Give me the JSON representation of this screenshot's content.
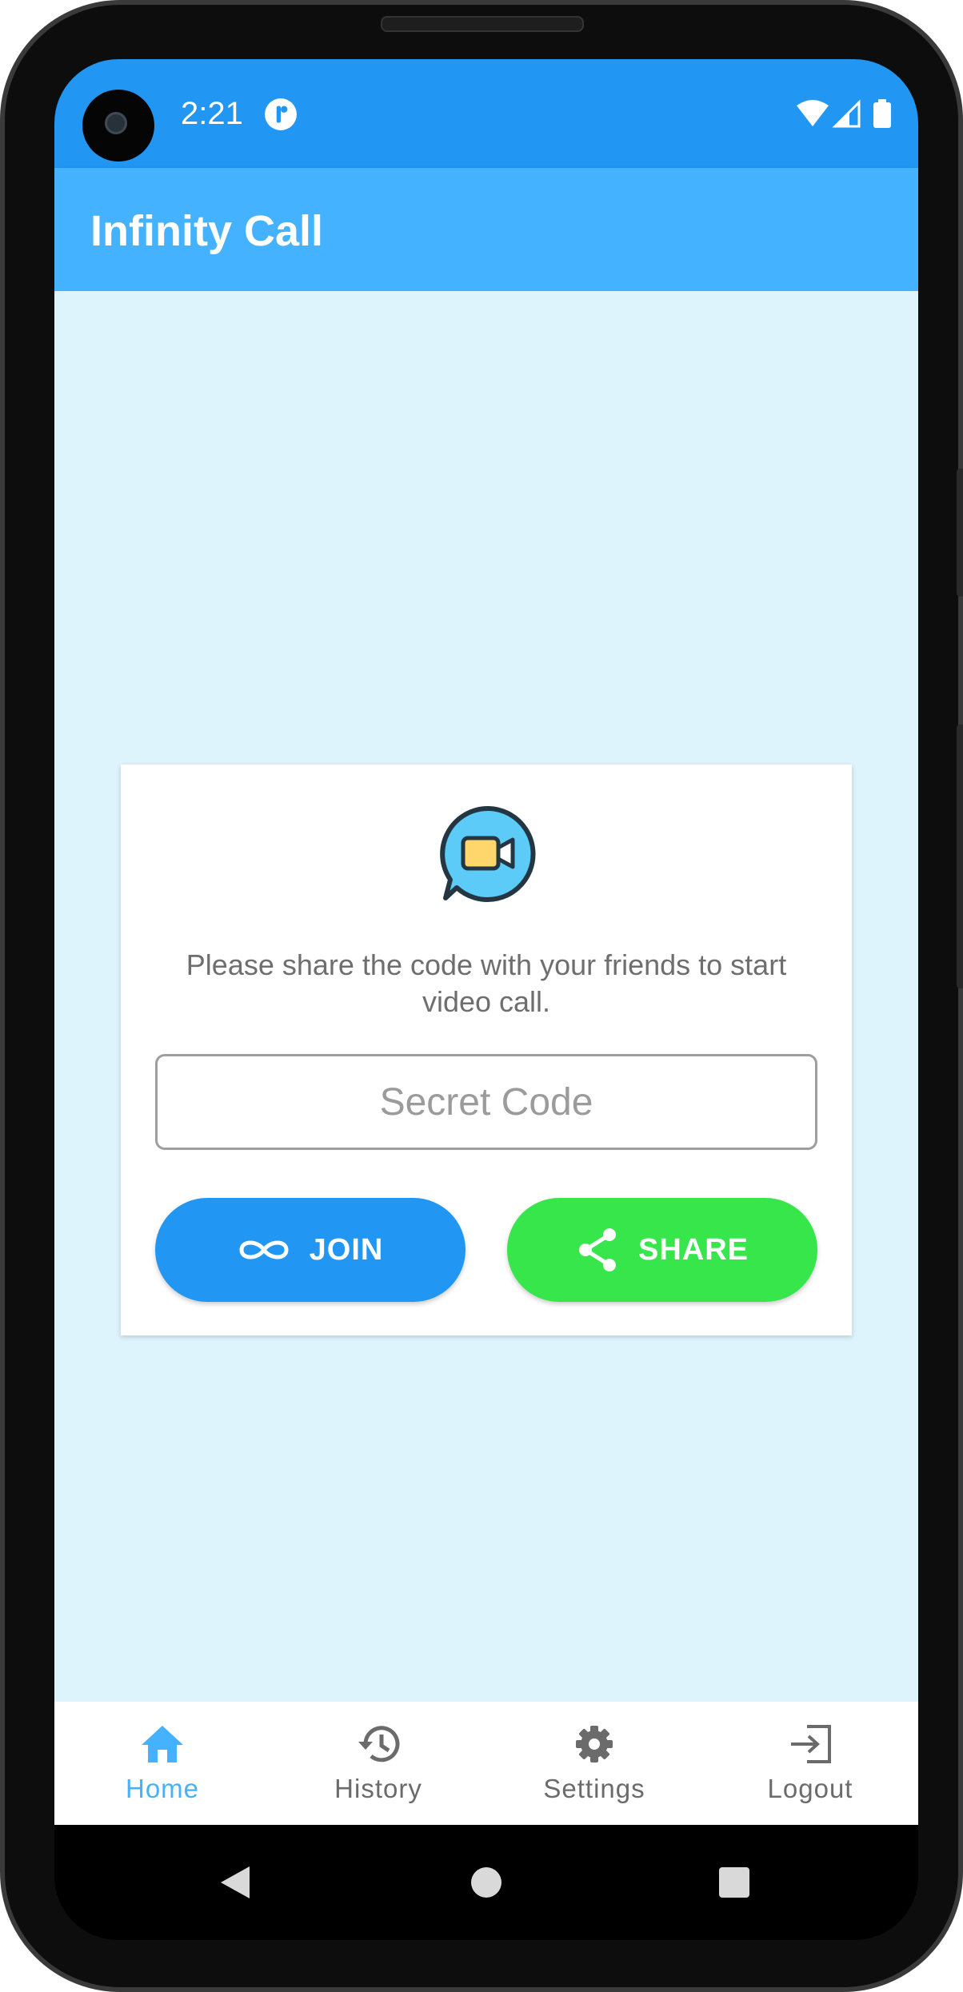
{
  "status_bar": {
    "time": "2:21"
  },
  "app_bar": {
    "title": "Infinity Call"
  },
  "card": {
    "message": "Please share the code with your friends to start video call.",
    "code_input": {
      "placeholder": "Secret Code",
      "value": ""
    },
    "join_label": "JOIN",
    "share_label": "SHARE"
  },
  "bottom_nav": {
    "items": [
      {
        "label": "Home",
        "icon": "home-icon",
        "active": true
      },
      {
        "label": "History",
        "icon": "history-icon",
        "active": false
      },
      {
        "label": "Settings",
        "icon": "gear-icon",
        "active": false
      },
      {
        "label": "Logout",
        "icon": "logout-icon",
        "active": false
      }
    ]
  },
  "colors": {
    "status_bar": "#2196f3",
    "app_bar": "#45b2ff",
    "background": "#def4fd",
    "join_button": "#2196f3",
    "share_button": "#37e64b",
    "nav_active": "#45b2ff",
    "nav_inactive": "#6b6b6b"
  }
}
